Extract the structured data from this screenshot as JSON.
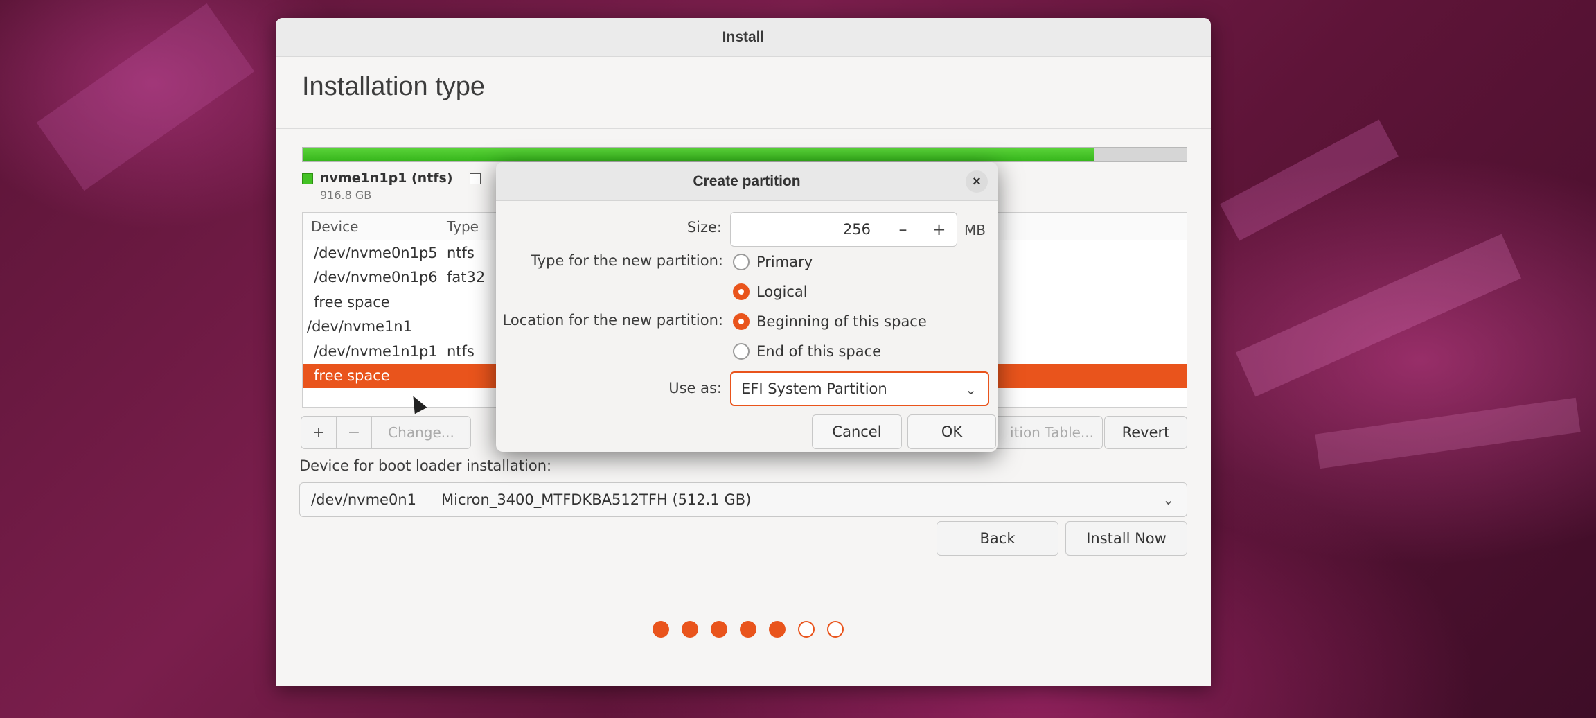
{
  "window": {
    "title": "Install"
  },
  "page": {
    "title": "Installation type"
  },
  "disk_bar": {
    "used_fraction": 0.895
  },
  "legend": [
    {
      "name": "nvme1n1p1 (ntfs)",
      "size": "916.8 GB",
      "color": "#43c224"
    }
  ],
  "table": {
    "headers": {
      "device": "Device",
      "type": "Type"
    },
    "rows": [
      {
        "device": "/dev/nvme0n1p5",
        "type": "ntfs"
      },
      {
        "device": "/dev/nvme0n1p6",
        "type": "fat32"
      },
      {
        "device": "free space",
        "type": ""
      },
      {
        "device": "/dev/nvme1n1",
        "type": ""
      },
      {
        "device": "/dev/nvme1n1p1",
        "type": "ntfs"
      },
      {
        "device": "free space",
        "type": ""
      }
    ]
  },
  "tools": {
    "add": "+",
    "remove": "−",
    "change": "Change...",
    "new_table": "ition Table...",
    "revert": "Revert"
  },
  "bootloader": {
    "label": "Device for boot loader installation:",
    "device": "/dev/nvme0n1",
    "model": "Micron_3400_MTFDKBA512TFH (512.1 GB)"
  },
  "nav": {
    "back": "Back",
    "install": "Install Now"
  },
  "progress": {
    "total_steps": 7,
    "completed_steps": 5
  },
  "dialog": {
    "title": "Create partition",
    "close": "×",
    "size_label": "Size:",
    "size_value": "256",
    "minus": "–",
    "plus": "+",
    "unit": "MB",
    "type_label": "Type for the new partition:",
    "type_options": [
      "Primary",
      "Logical"
    ],
    "type_selected": "Logical",
    "location_label": "Location for the new partition:",
    "location_options": [
      "Beginning of this space",
      "End of this space"
    ],
    "location_selected": "Beginning of this space",
    "use_label": "Use as:",
    "use_value": "EFI System Partition",
    "cancel": "Cancel",
    "ok": "OK"
  },
  "colors": {
    "accent": "#e9541c",
    "partition_green": "#43c224"
  }
}
